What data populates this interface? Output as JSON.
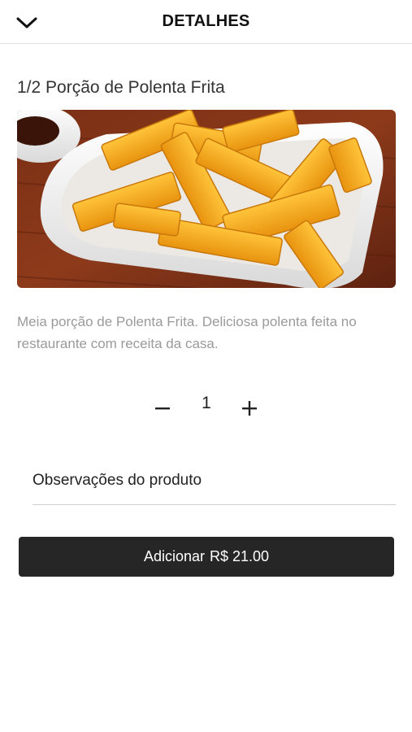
{
  "header": {
    "title": "DETALHES",
    "back_icon": "chevron-down-icon"
  },
  "product": {
    "title": "1/2 Porção de Polenta Frita",
    "description": "Meia porção de Polenta Frita. Deliciosa polenta feita no restaurante com receita da casa.",
    "image_alt": "Polenta frita em travessa branca"
  },
  "quantity": {
    "value": "1",
    "minus_label": "−",
    "plus_label": "+"
  },
  "notes": {
    "label": "Observações do produto"
  },
  "add_button": {
    "label": "Adicionar",
    "price": "R$ 21.00"
  },
  "colors": {
    "button_bg": "#262626",
    "description_text": "#9a9a9a",
    "divider": "#e2e2e2"
  }
}
